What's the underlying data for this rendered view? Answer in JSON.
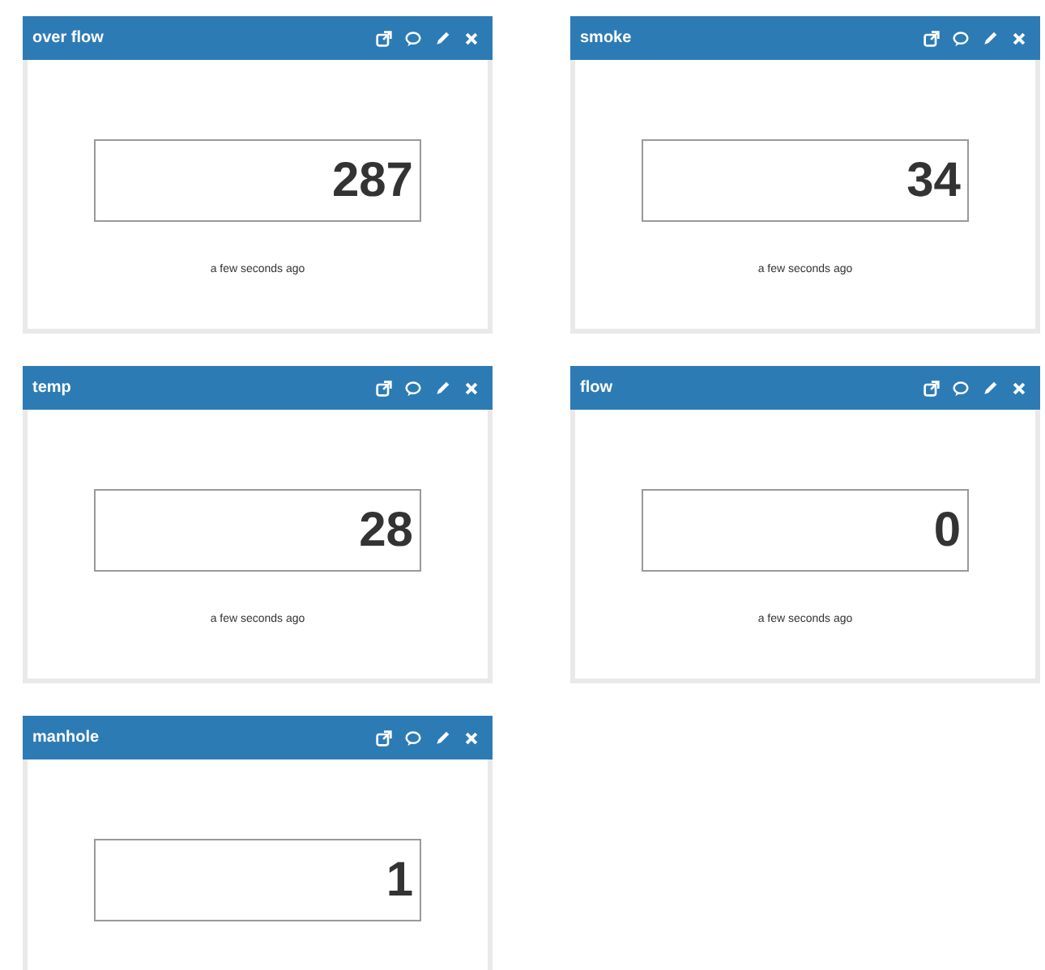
{
  "widgets": [
    {
      "title": "over flow",
      "value": "287",
      "timestamp": "a few seconds ago"
    },
    {
      "title": "smoke",
      "value": "34",
      "timestamp": "a few seconds ago"
    },
    {
      "title": "temp",
      "value": "28",
      "timestamp": "a few seconds ago"
    },
    {
      "title": "flow",
      "value": "0",
      "timestamp": "a few seconds ago"
    },
    {
      "title": "manhole",
      "value": "1"
    }
  ]
}
